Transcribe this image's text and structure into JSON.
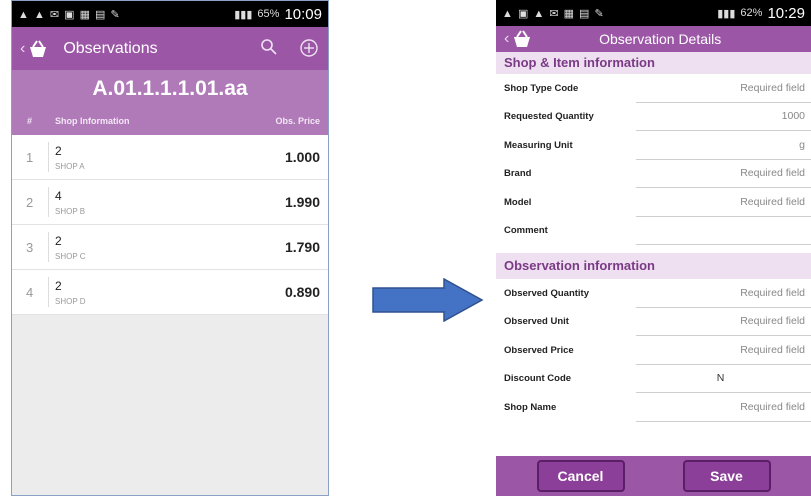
{
  "status_bar_left": {
    "time": "10:09",
    "battery": "65%"
  },
  "status_bar_right": {
    "time": "10:29",
    "battery": "62%"
  },
  "observations_screen": {
    "title": "Observations",
    "item_code": "A.01.1.1.1.01.aa",
    "columns": {
      "hash": "#",
      "shop_info": "Shop Information",
      "price": "Obs. Price"
    },
    "rows": [
      {
        "index": "1",
        "quantity": "2",
        "shop": "SHOP A",
        "price": "1.000"
      },
      {
        "index": "2",
        "quantity": "4",
        "shop": "SHOP B",
        "price": "1.990"
      },
      {
        "index": "3",
        "quantity": "2",
        "shop": "SHOP C",
        "price": "1.790"
      },
      {
        "index": "4",
        "quantity": "2",
        "shop": "SHOP D",
        "price": "0.890"
      }
    ]
  },
  "details_screen": {
    "title": "Observation Details",
    "section_shop": "Shop & Item information",
    "shop_fields": [
      {
        "label": "Shop Type Code",
        "value": "Required field"
      },
      {
        "label": "Requested Quantity",
        "value": "1000"
      },
      {
        "label": "Measuring Unit",
        "value": "g"
      },
      {
        "label": "Brand",
        "value": "Required field"
      },
      {
        "label": "Model",
        "value": "Required field"
      },
      {
        "label": "Comment",
        "value": ""
      }
    ],
    "section_obs": "Observation information",
    "obs_fields": [
      {
        "label": "Observed Quantity",
        "value": "Required field"
      },
      {
        "label": "Observed Unit",
        "value": "Required field"
      },
      {
        "label": "Observed Price",
        "value": "Required field"
      },
      {
        "label": "Discount Code",
        "value": "N"
      },
      {
        "label": "Shop Name",
        "value": "Required field"
      }
    ],
    "cancel_label": "Cancel",
    "save_label": "Save"
  },
  "colors": {
    "purple_bar": "#9b57a6",
    "purple_light": "#b07ab9",
    "arrow": "#4472c4"
  }
}
